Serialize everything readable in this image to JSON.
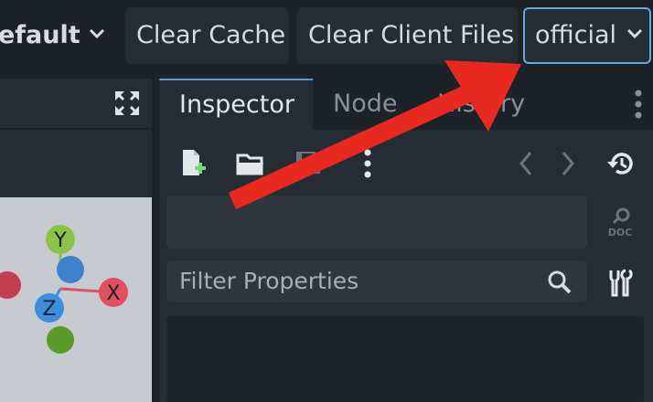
{
  "toolbar": {
    "scene_select": "efault",
    "clear_cache": "Clear Cache",
    "clear_client_files": "Clear Client Files",
    "branch_select": "official"
  },
  "inspector": {
    "tabs": [
      "Inspector",
      "Node",
      "History"
    ],
    "filter_placeholder": "Filter Properties"
  },
  "gizmo": {
    "y": "Y",
    "x": "X",
    "z": "Z"
  },
  "colors": {
    "accent_border": "#6aa6e0",
    "arrow": "#e8291f",
    "y_axis": "#8bc34a",
    "x_axis": "#e05060",
    "z_axis": "#3b8ee0"
  },
  "icons": [
    "chevron-down-icon",
    "fullscreen-icon",
    "new-file-icon",
    "folder-open-icon",
    "save-icon",
    "kebab-menu-icon",
    "history-icon",
    "doc-search-icon",
    "search-icon",
    "tools-icon"
  ]
}
